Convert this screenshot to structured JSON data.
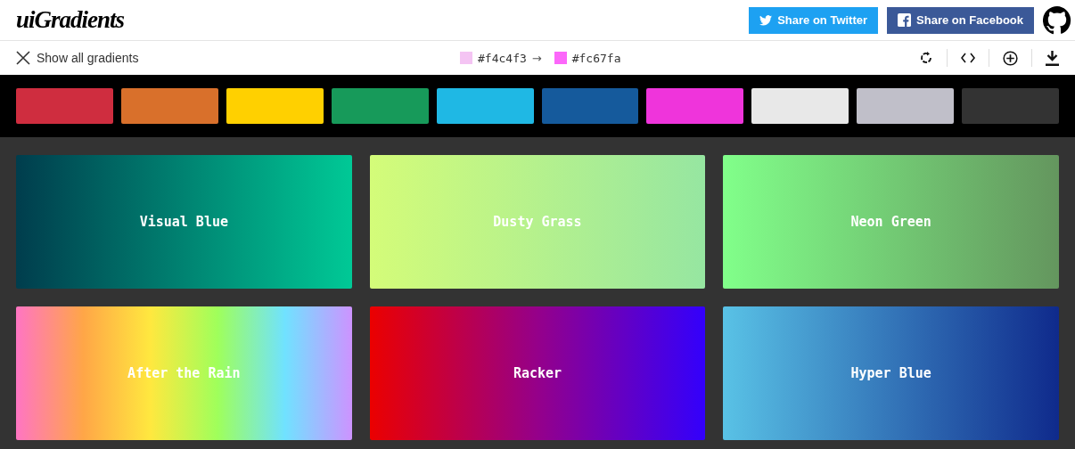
{
  "header": {
    "logo": "uiGradients",
    "buttons": [
      {
        "kind": "twitter",
        "label": "Share on Twitter"
      },
      {
        "kind": "facebook",
        "label": "Share on Facebook"
      }
    ]
  },
  "toolbar": {
    "back": "Show all gradients",
    "from": {
      "hex": "#f4c4f3",
      "color": "#f4c4f3"
    },
    "arrow": "→",
    "to": {
      "hex": "#fc67fa",
      "color": "#fc67fa"
    }
  },
  "palette": [
    {
      "color": "#cf2d3f"
    },
    {
      "color": "#d9702b"
    },
    {
      "color": "#ffd000"
    },
    {
      "color": "#179a5a"
    },
    {
      "color": "#1fb8e4"
    },
    {
      "color": "#155a9c"
    },
    {
      "color": "#ef34db"
    },
    {
      "color": "#e8e8e8"
    },
    {
      "color": "#c0bfc9"
    },
    {
      "color": "#333333"
    }
  ],
  "gradients": [
    {
      "name": "Visual Blue",
      "stops": [
        {
          "color": "#003d4d"
        },
        {
          "color": "#00c996"
        }
      ]
    },
    {
      "name": "Dusty Grass",
      "stops": [
        {
          "color": "#d4fc79"
        },
        {
          "color": "#96e6a1"
        }
      ]
    },
    {
      "name": "Neon Green",
      "stops": [
        {
          "color": "#81ff8a"
        },
        {
          "color": "#64965e"
        }
      ]
    },
    {
      "name": "After the Rain",
      "stops": [
        {
          "color": "#ff75c3"
        },
        {
          "color": "#ffa647"
        },
        {
          "color": "#ffe83f"
        },
        {
          "color": "#9fff5b"
        },
        {
          "color": "#70e2ff"
        },
        {
          "color": "#cd93ff"
        }
      ]
    },
    {
      "name": "Racker",
      "stops": [
        {
          "color": "#eb0000"
        },
        {
          "color": "#95008a"
        },
        {
          "color": "#3300fc"
        }
      ]
    },
    {
      "name": "Hyper Blue",
      "stops": [
        {
          "color": "#59c2e6"
        },
        {
          "color": "#0f2a8c"
        }
      ]
    }
  ]
}
